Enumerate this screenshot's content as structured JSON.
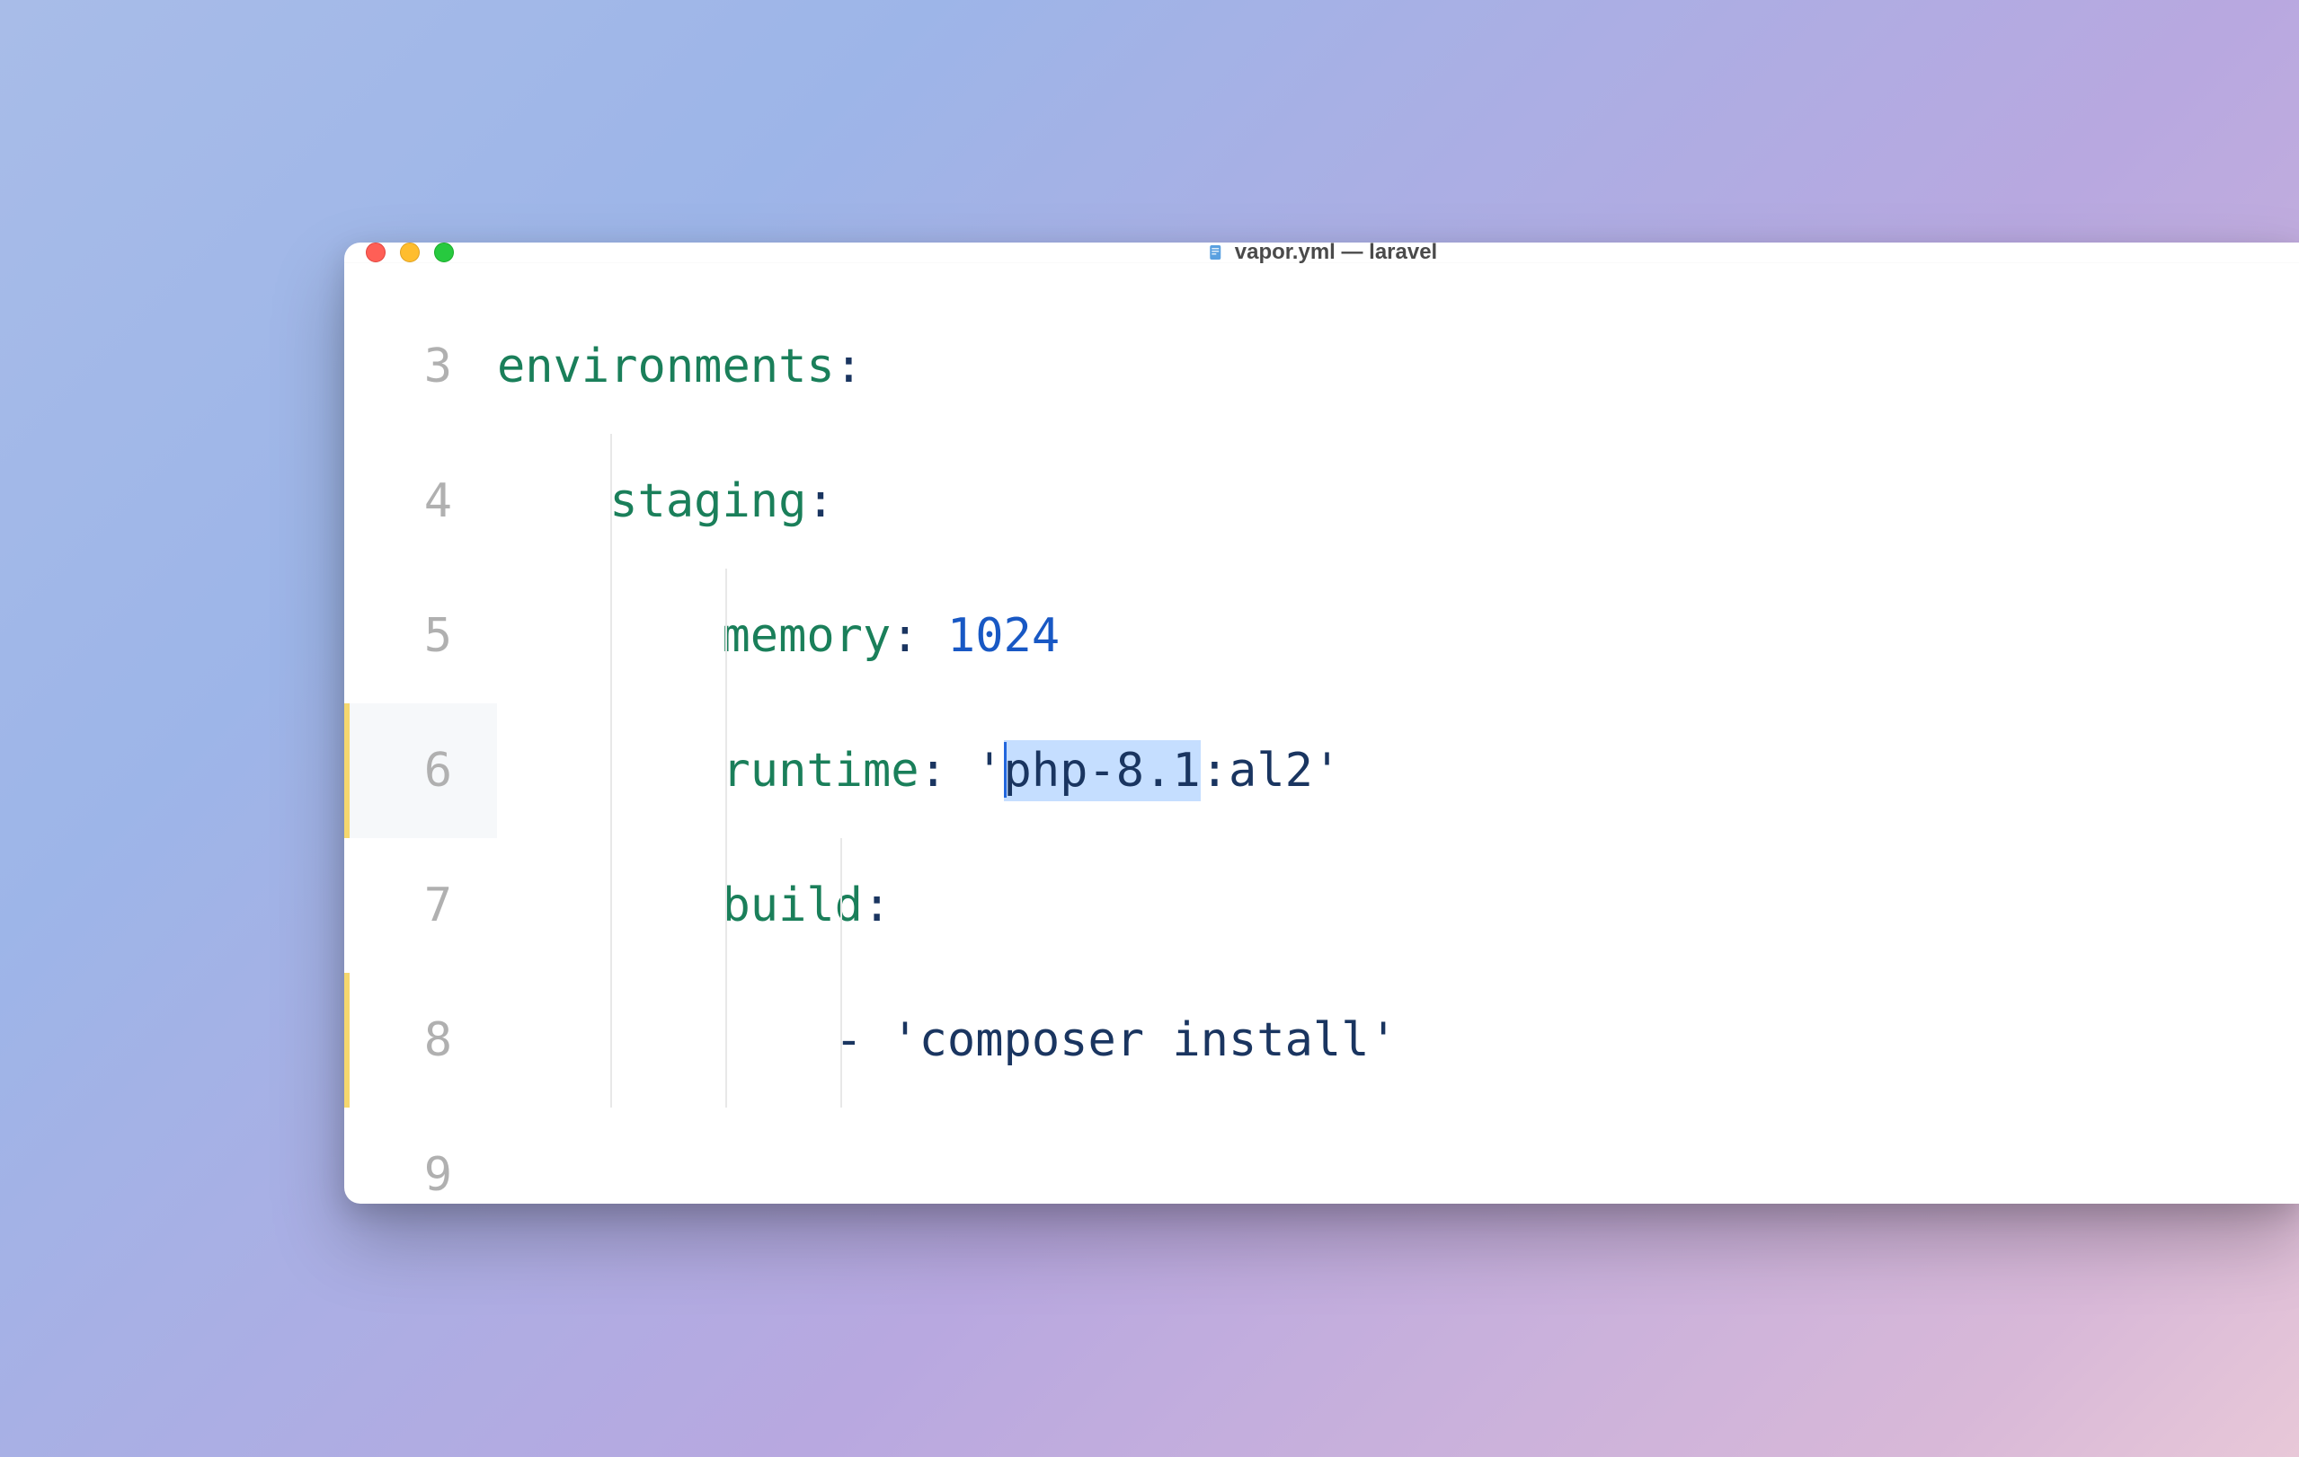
{
  "window": {
    "title": "vapor.yml — laravel",
    "file_icon": "📄"
  },
  "editor": {
    "active_line": 6,
    "lines": [
      {
        "number": 3,
        "indent": 0,
        "modified": false,
        "tokens": [
          {
            "type": "key",
            "text": "environments"
          },
          {
            "type": "punct",
            "text": ":"
          }
        ]
      },
      {
        "number": 4,
        "indent": 1,
        "modified": false,
        "tokens": [
          {
            "type": "key",
            "text": "staging"
          },
          {
            "type": "punct",
            "text": ":"
          }
        ]
      },
      {
        "number": 5,
        "indent": 2,
        "modified": false,
        "tokens": [
          {
            "type": "key",
            "text": "memory"
          },
          {
            "type": "punct",
            "text": ": "
          },
          {
            "type": "number",
            "text": "1024"
          }
        ]
      },
      {
        "number": 6,
        "indent": 2,
        "modified": true,
        "tokens": [
          {
            "type": "key",
            "text": "runtime"
          },
          {
            "type": "punct",
            "text": ": "
          },
          {
            "type": "string",
            "text": "'"
          },
          {
            "type": "cursor",
            "text": ""
          },
          {
            "type": "string-selected",
            "text": "php-8.1"
          },
          {
            "type": "string",
            "text": ":al2'"
          }
        ]
      },
      {
        "number": 7,
        "indent": 2,
        "modified": false,
        "tokens": [
          {
            "type": "key",
            "text": "build"
          },
          {
            "type": "punct",
            "text": ":"
          }
        ]
      },
      {
        "number": 8,
        "indent": 3,
        "modified": true,
        "tokens": [
          {
            "type": "punct",
            "text": "- "
          },
          {
            "type": "string",
            "text": "'composer install'"
          }
        ]
      },
      {
        "number": 9,
        "indent": 0,
        "modified": false,
        "tokens": []
      }
    ]
  },
  "colors": {
    "key": "#1a7f5a",
    "punct": "#1a3560",
    "number": "#1858c4",
    "string": "#1a3560",
    "selection_bg": "#c5deff"
  }
}
